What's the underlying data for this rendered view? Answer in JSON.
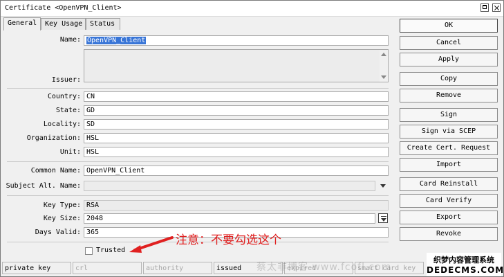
{
  "window": {
    "title": "Certificate <OpenVPN_Client>"
  },
  "tabs": [
    {
      "label": "General"
    },
    {
      "label": "Key Usage"
    },
    {
      "label": "Status"
    }
  ],
  "form": {
    "name_label": "Name:",
    "name_value": "OpenVPN_Client",
    "issuer_label": "Issuer:",
    "country_label": "Country:",
    "country_value": "CN",
    "state_label": "State:",
    "state_value": "GD",
    "locality_label": "Locality:",
    "locality_value": "SD",
    "organization_label": "Organization:",
    "organization_value": "HSL",
    "unit_label": "Unit:",
    "unit_value": "HSL",
    "common_name_label": "Common Name:",
    "common_name_value": "OpenVPN_Client",
    "subject_alt_label": "Subject Alt. Name:",
    "subject_alt_value": "",
    "key_type_label": "Key Type:",
    "key_type_value": "RSA",
    "key_size_label": "Key Size:",
    "key_size_value": "2048",
    "days_valid_label": "Days Valid:",
    "days_valid_value": "365",
    "trusted_label": "Trusted"
  },
  "buttons": {
    "ok": "OK",
    "cancel": "Cancel",
    "apply": "Apply",
    "copy": "Copy",
    "remove": "Remove",
    "sign": "Sign",
    "sign_scep": "Sign via SCEP",
    "create_request": "Create Cert. Request",
    "import": "Import",
    "card_reinstall": "Card Reinstall",
    "card_verify": "Card Verify",
    "export": "Export",
    "revoke": "Revoke"
  },
  "annotation": {
    "text": "注意：不要勾选这个",
    "color": "#e02020"
  },
  "status": {
    "private_key": "private key",
    "crl": "crl",
    "authority": "authority",
    "issued": "issued",
    "expired": "expired",
    "smart_card_key": "smart card key"
  },
  "watermark": {
    "site_text": "蔡太非博客 www.fcofl.com",
    "badge_line1": "织梦内容管理系统",
    "badge_line2": "DEDECMS.COM"
  },
  "colors": {
    "selection": "#3875d7",
    "annotation": "#e02020"
  }
}
